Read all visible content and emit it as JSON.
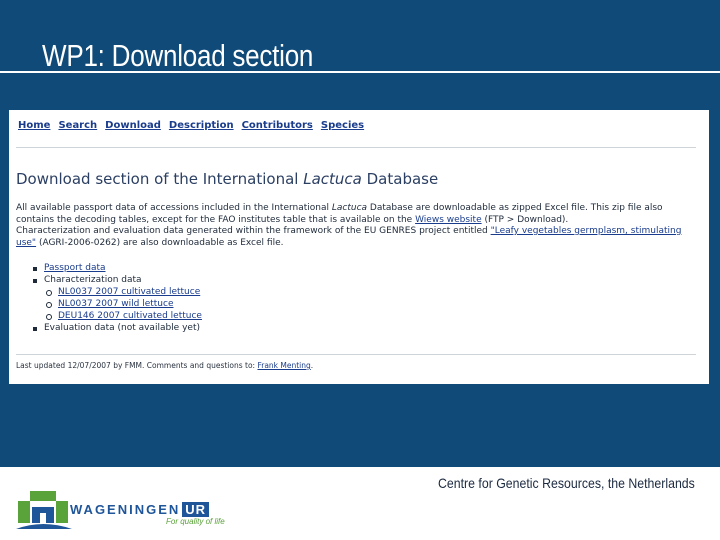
{
  "slide": {
    "title": "WP1: Download section",
    "footer_org": "Centre for Genetic Resources, the Netherlands"
  },
  "webpage": {
    "nav": [
      "Home",
      "Search",
      "Download",
      "Description",
      "Contributors",
      "Species"
    ],
    "heading_before": "Download section of the International ",
    "heading_italic": "Lactuca",
    "heading_after": " Database",
    "intro": {
      "p1": "All available passport data of accessions included in the International ",
      "p1_italic": "Lactuca",
      "p2": " Database are downloadable as zipped Excel file. This zip file also contains the decoding tables, except for the FAO institutes table that is available on the ",
      "wiews_link": "Wiews website",
      "p3": " (FTP > Download).",
      "p4": "Characterization and evaluation data generated within the framework of the EU GENRES project entitled ",
      "project_link": "\"Leafy vegetables germplasm, stimulating use\"",
      "p5": " (AGRI-2006-0262) are also downloadable as Excel file."
    },
    "list": {
      "passport": "Passport data",
      "characterization": "Characterization data",
      "char_items": [
        "NL0037 2007 cultivated lettuce",
        "NL0037 2007 wild lettuce",
        "DEU146 2007 cultivated lettuce"
      ],
      "evaluation": "Evaluation data (not available yet)"
    },
    "updated_prefix": "Last updated 12/07/2007 by FMM. Comments and questions to: ",
    "updated_link": "Frank Menting"
  },
  "logo": {
    "name": "WAGENINGEN",
    "ur": "UR",
    "tagline": "For quality of life",
    "colors": {
      "blue": "#1f5599",
      "green": "#5aa23a"
    }
  },
  "colors": {
    "background": "#0f4a78",
    "link": "#1a3c8c"
  }
}
